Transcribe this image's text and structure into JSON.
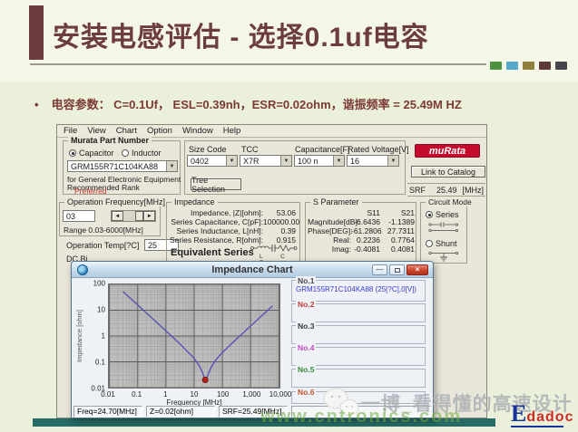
{
  "slide": {
    "title": "安装电感评估 - 选择0.1uf电容",
    "bullet_marker": "•",
    "bullet": "电容参数： C=0.1Uf， ESL=0.39nh，ESR=0.02ohm，谐振频率 = 25.49M HZ",
    "accent_colors": [
      "#4e9140",
      "#57a9c9",
      "#90803c",
      "#5e3a34",
      "#45454d"
    ]
  },
  "icons": {
    "dropdown": "▼",
    "scroll_left": "◄",
    "scroll_right": "►",
    "minimize": "—",
    "close": "×"
  },
  "app": {
    "menu": [
      "File",
      "View",
      "Chart",
      "Option",
      "Window",
      "Help"
    ],
    "part_group": {
      "label": "Murata Part Number",
      "capacitor": "Capacitor",
      "inductor": "Inductor",
      "part_number": "GRM155R71C104KA88",
      "desc1": "for General Electronic Equipment",
      "desc2": "Recommended Rank",
      "rank": "Preferred"
    },
    "selectors": {
      "size_code_label": "Size Code",
      "size_code": "0402",
      "tcc_label": "TCC",
      "tcc": "X7R",
      "capacitance_label": "Capacitance[F]",
      "capacitance": "100 n",
      "rated_voltage_label": "Rated Voltage[V]",
      "rated_voltage": "16",
      "tree_selection": "Tree Selection"
    },
    "brand": "muRata",
    "link_to_catalog": "Link to Catalog",
    "srf": {
      "label": "SRF",
      "value": "25.49",
      "unit": "[MHz]"
    },
    "op_freq": {
      "label": "Operation Frequency[MHz]",
      "value": "03",
      "range": "Range 0.03-6000[MHz]"
    },
    "op_temp": {
      "label": "Operation Temp[?C]",
      "value": "25"
    },
    "dc_bias_partial": "DC Bi",
    "impedance": {
      "label": "Impedance",
      "rows": [
        {
          "label": "Impedance, |Z|[ohm]:",
          "value": "53.06"
        },
        {
          "label": "Series Capacitance, C[pF]:",
          "value": "100000.00"
        },
        {
          "label": "Series Inductance, L[nH]:",
          "value": "0.39"
        },
        {
          "label": "Series Resistance, R[ohm]:",
          "value": "0.915"
        }
      ],
      "equivalent": "Equivalent Series",
      "lcr": "L C R"
    },
    "s_parameter": {
      "label": "S Parameter",
      "columns": [
        "S11",
        "S21"
      ],
      "rows": [
        {
          "label": "Magnitude[dB]:",
          "s11": "-6.6436",
          "s21": "-1.1389"
        },
        {
          "label": "Phase[DEG]:",
          "s11": "-61.2806",
          "s21": "27.7311"
        },
        {
          "label": "Real:",
          "s11": "0.2236",
          "s21": "0.7764"
        },
        {
          "label": "Imag:",
          "s11": "-0.4081",
          "s21": "0.4081"
        }
      ]
    },
    "circuit_mode": {
      "label": "Circuit Mode",
      "series": "Series",
      "shunt": "Shunt"
    }
  },
  "chart_window": {
    "title": "Impedance Chart",
    "legend": [
      {
        "label": "No.1",
        "text": "GRM155R71C104KA88 (25[?C],0[V])",
        "text_color": "#3a3acc",
        "label_color": "#4a4a4a"
      },
      {
        "label": "No.2",
        "text": "",
        "label_color": "#c43a3a"
      },
      {
        "label": "No.3",
        "text": "",
        "label_color": "#3a3a3a"
      },
      {
        "label": "No.4",
        "text": "",
        "label_color": "#c04ac0"
      },
      {
        "label": "No.5",
        "text": "",
        "label_color": "#3a8a3a"
      },
      {
        "label": "No.6",
        "text": "",
        "label_color": "#c0542a"
      }
    ],
    "status": [
      "Freq=24.70[MHz]",
      "Z=0.02[ohm]",
      "SRF=25.49[MHz]"
    ]
  },
  "chart_data": {
    "type": "line",
    "title": "Impedance Chart",
    "xlabel": "Frequency [MHz]",
    "ylabel": "Impedance [ohm]",
    "xscale": "log",
    "yscale": "log",
    "xlim": [
      0.01,
      10000
    ],
    "ylim": [
      0.01,
      100
    ],
    "x_ticks": [
      "0.01",
      "0.1",
      "1",
      "10",
      "100",
      "1,000",
      "10,000"
    ],
    "y_ticks": [
      "100",
      "10",
      "1",
      "0.1",
      "0.01"
    ],
    "grid": true,
    "legend_position": "right",
    "series": [
      {
        "name": "GRM155R71C104KA88 (25[?C],0[V])",
        "color": "#5c58b2",
        "points": [
          [
            0.03,
            53.05
          ],
          [
            0.1,
            15.92
          ],
          [
            0.3,
            5.31
          ],
          [
            1,
            1.59
          ],
          [
            3,
            0.52
          ],
          [
            10,
            0.136
          ],
          [
            15,
            0.072
          ],
          [
            20,
            0.037
          ],
          [
            23,
            0.024
          ],
          [
            25.49,
            0.02
          ],
          [
            28,
            0.023
          ],
          [
            32,
            0.035
          ],
          [
            40,
            0.062
          ],
          [
            60,
            0.122
          ],
          [
            100,
            0.23
          ],
          [
            300,
            0.73
          ],
          [
            1000,
            2.45
          ],
          [
            3000,
            7.35
          ],
          [
            6000,
            14.7
          ]
        ]
      }
    ],
    "marker": {
      "x": 24.7,
      "y": 0.02,
      "color": "#b02420"
    }
  },
  "watermark": {
    "handle": "一博_看得懂的高速设计",
    "url": "www.cntronics.com",
    "logo_first": "E",
    "logo_rest": "dadoc"
  }
}
